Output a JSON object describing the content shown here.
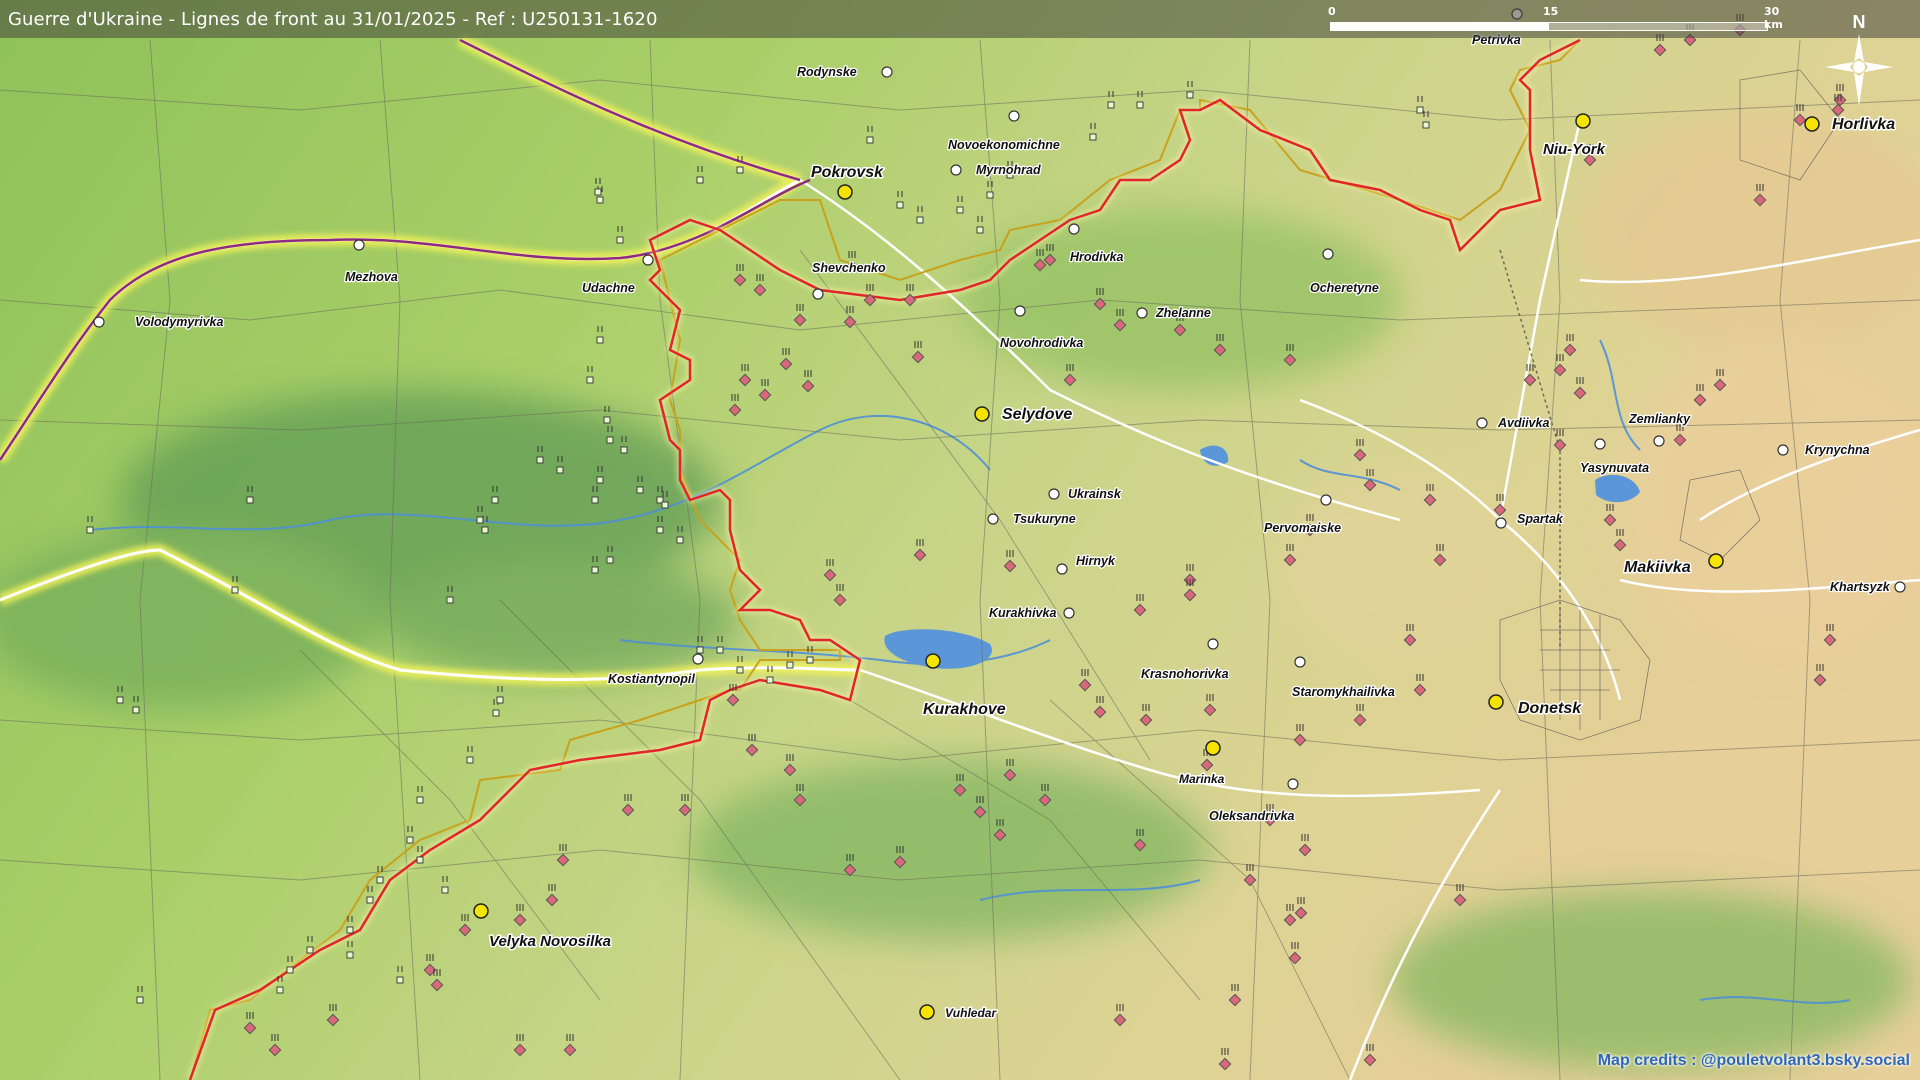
{
  "header": {
    "title": "Guerre d'Ukraine - Lignes de front au 31/01/2025 - Ref : U250131-1620"
  },
  "scale_bar": {
    "ticks": [
      "0",
      "15",
      "30 km"
    ]
  },
  "north_arrow": {
    "label": "N"
  },
  "credits": "Map credits : @pouletvolant3.bsky.social",
  "colors": {
    "front_line": "#e0262b",
    "previous_front_line": "#c8a21c",
    "major_road_glow": "#f2f25a",
    "railway": "#8e2a7e",
    "city_marker": "#f5e400",
    "unit_marker": "#d9687b",
    "water": "#4f8fd6"
  },
  "cities": [
    {
      "name": "Pokrovsk"
    },
    {
      "name": "Selydove"
    },
    {
      "name": "Kurakhove"
    },
    {
      "name": "Donetsk"
    },
    {
      "name": "Makiivka"
    },
    {
      "name": "Horlivka"
    },
    {
      "name": "Niu-York"
    },
    {
      "name": "Velyka Novosilka"
    },
    {
      "name": "Marinka"
    },
    {
      "name": "Vuhledar"
    }
  ],
  "towns": [
    {
      "name": "Rodynske"
    },
    {
      "name": "Novoekonomichne"
    },
    {
      "name": "Myrnohrad"
    },
    {
      "name": "Mezhova"
    },
    {
      "name": "Udachne"
    },
    {
      "name": "Shevchenko"
    },
    {
      "name": "Hrodivka"
    },
    {
      "name": "Ocheretyne"
    },
    {
      "name": "Volodymyrivka"
    },
    {
      "name": "Zhelanne"
    },
    {
      "name": "Novohrodivka"
    },
    {
      "name": "Ukrainsk"
    },
    {
      "name": "Tsukuryne"
    },
    {
      "name": "Hirnyk"
    },
    {
      "name": "Kurakhivka"
    },
    {
      "name": "Krasnohorivka"
    },
    {
      "name": "Staromykhailivka"
    },
    {
      "name": "Oleksandrivka"
    },
    {
      "name": "Kostiantynopil"
    },
    {
      "name": "Pervomaiske"
    },
    {
      "name": "Avdiivka"
    },
    {
      "name": "Zemlianky"
    },
    {
      "name": "Yasynuvata"
    },
    {
      "name": "Krynychna"
    },
    {
      "name": "Spartak"
    },
    {
      "name": "Khartsyzk"
    },
    {
      "name": "Petrivka"
    }
  ]
}
